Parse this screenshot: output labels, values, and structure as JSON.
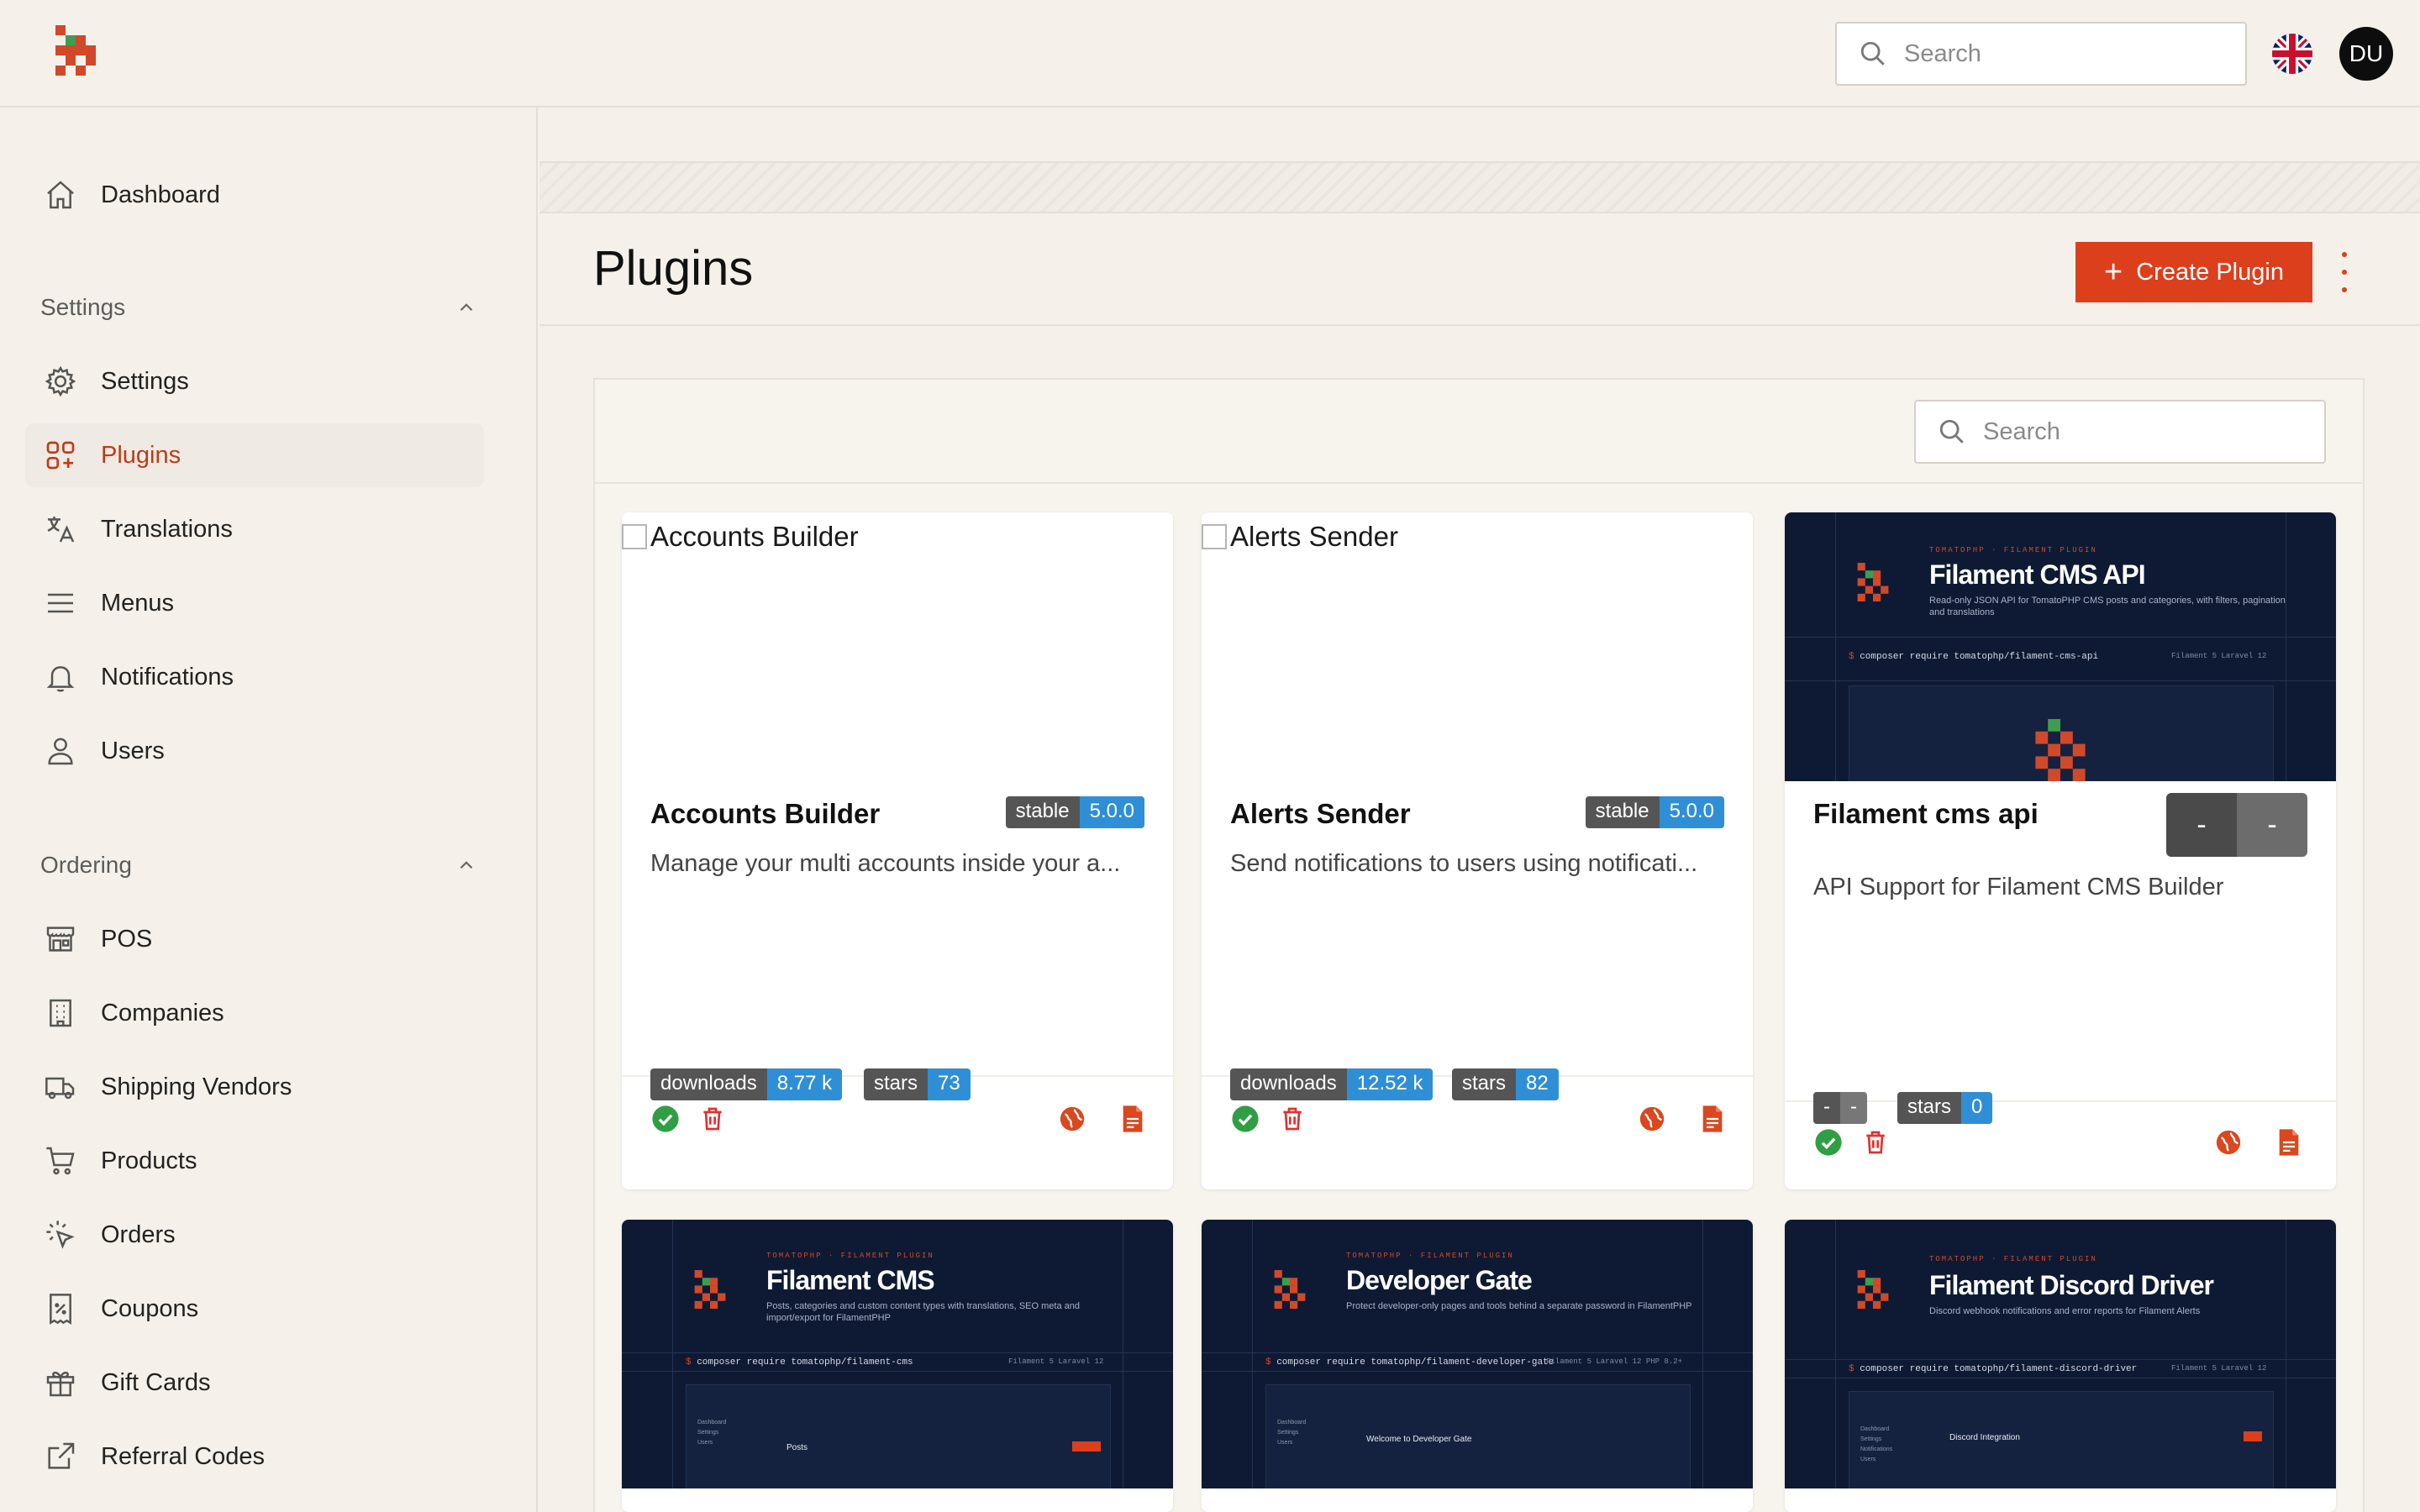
{
  "topbar": {
    "search_placeholder": "Search",
    "avatar_initials": "DU"
  },
  "sidebar": {
    "dashboard": "Dashboard",
    "groups": [
      {
        "label": "Settings",
        "items": [
          "Settings",
          "Plugins",
          "Translations",
          "Menus",
          "Notifications",
          "Users"
        ]
      },
      {
        "label": "Ordering",
        "items": [
          "POS",
          "Companies",
          "Shipping Vendors",
          "Products",
          "Orders",
          "Coupons",
          "Gift Cards",
          "Referral Codes"
        ]
      }
    ],
    "active_item": "Plugins"
  },
  "page": {
    "title": "Plugins",
    "create_label": "Create Plugin",
    "search_placeholder": "Search"
  },
  "colors": {
    "accent": "#dc3f1c",
    "background": "#f5f1ea",
    "badge_blue": "#2f8fd6",
    "badge_gray": "#555555",
    "dark_thumb": "#0e1a33"
  },
  "cards": [
    {
      "title": "Accounts Builder",
      "thumb_alt": "Accounts Builder",
      "stability": "stable",
      "version": "5.0.0",
      "description": "Manage your multi accounts inside your a...",
      "downloads_label": "downloads",
      "downloads": "8.77 k",
      "stars_label": "stars",
      "stars": "73"
    },
    {
      "title": "Alerts Sender",
      "thumb_alt": "Alerts Sender",
      "stability": "stable",
      "version": "5.0.0",
      "description": "Send notifications to users using notificati...",
      "downloads_label": "downloads",
      "downloads": "12.52 k",
      "stars_label": "stars",
      "stars": "82"
    },
    {
      "title": "Filament cms api",
      "stability": "-",
      "version": "-",
      "description": "API Support for Filament CMS Builder",
      "downloads_label": "-",
      "downloads": "-",
      "stars_label": "stars",
      "stars": "0",
      "thumb": {
        "kicker": "TOMATOPHP · FILAMENT PLUGIN",
        "heading": "Filament CMS API",
        "subtitle": "Read-only JSON API for TomatoPHP CMS posts and categories, with filters, pagination and translations",
        "command": "composer require tomatophp/filament-cms-api",
        "tags": "Filament 5    Laravel 12"
      }
    }
  ],
  "thumbs_row2": [
    {
      "kicker": "TOMATOPHP · FILAMENT PLUGIN",
      "heading": "Filament CMS",
      "subtitle": "Posts, categories and custom content types with translations, SEO meta and import/export for FilamentPHP",
      "command": "composer require tomatophp/filament-cms",
      "tags": "Filament 5    Laravel 12",
      "screen_title": "Posts",
      "side": "Dashboard\nSettings\nUsers"
    },
    {
      "kicker": "TOMATOPHP · FILAMENT PLUGIN",
      "heading": "Developer Gate",
      "subtitle": "Protect developer-only pages and tools behind a separate password in FilamentPHP",
      "command": "composer require tomatophp/filament-developer-gate",
      "tags": "Filament 5    Laravel 12    PHP 8.2+",
      "screen_title": "Welcome to Developer Gate",
      "side": "Dashboard\nSettings\nUsers"
    },
    {
      "kicker": "TOMATOPHP · FILAMENT PLUGIN",
      "heading": "Filament Discord Driver",
      "subtitle": "Discord webhook notifications and error reports for Filament Alerts",
      "command": "composer require tomatophp/filament-discord-driver",
      "tags": "Filament 5    Laravel 12",
      "screen_title": "Discord Integration",
      "side": "Dashboard\nSettings\nNotifications\nUsers"
    }
  ]
}
